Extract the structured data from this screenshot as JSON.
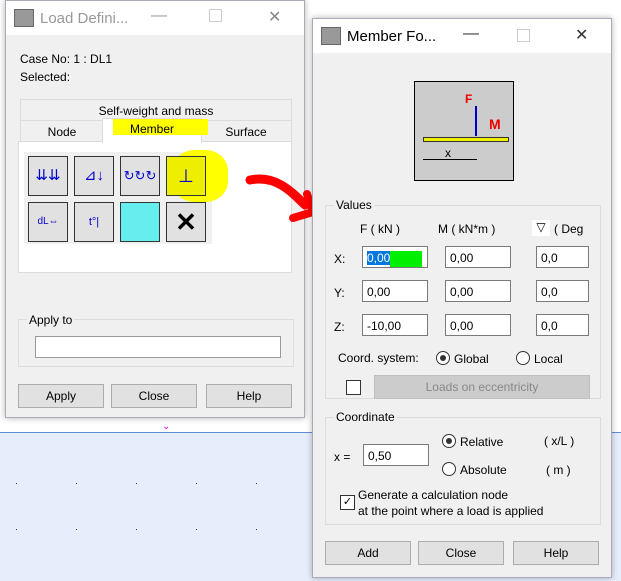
{
  "load_dialog": {
    "title": "Load Defini...",
    "case_no": "Case No: 1 : DL1",
    "selected": "Selected:",
    "tab_top": "Self-weight and mass",
    "tabs": [
      "Node",
      "Member",
      "Surface"
    ],
    "apply_to_label": "Apply to",
    "apply_to_value": "",
    "buttons": [
      "Apply",
      "Close",
      "Help"
    ],
    "tools": [
      "uniform-load-icon",
      "trapezoidal-load-icon",
      "moment-load-icon",
      "concentrated-force-icon",
      "dilatation-load-icon",
      "thermal-load-icon",
      "surface-load-icon",
      "delete-load-icon"
    ]
  },
  "member_dialog": {
    "title": "Member Fo...",
    "values_label": "Values",
    "col_headers": [
      "F  ( kN )",
      "M  ( kN*m )",
      "( Deg"
    ],
    "rows": [
      {
        "axis": "X:",
        "f": "0,00",
        "m": "0,00",
        "deg": "0,0"
      },
      {
        "axis": "Y:",
        "f": "0,00",
        "m": "0,00",
        "deg": "0,0"
      },
      {
        "axis": "Z:",
        "f": "-10,00",
        "m": "0,00",
        "deg": "0,0"
      }
    ],
    "diagram": {
      "f": "F",
      "m": "M",
      "x": "x"
    },
    "coord_label": "Coord. system:",
    "coord_options": [
      "Global",
      "Local"
    ],
    "coord_selected": "Global",
    "eccentricity_button": "Loads on eccentricity",
    "coordinate_label": "Coordinate",
    "x_label": "x =",
    "x_value": "0,50",
    "pos_options": [
      "Relative",
      "Absolute"
    ],
    "pos_selected": "Relative",
    "units": [
      "( x/L )",
      "( m )"
    ],
    "generate_node_checked": true,
    "generate_node_text_1": "Generate a calculation node",
    "generate_node_text_2": "at the point where a load is applied",
    "buttons": [
      "Add",
      "Close",
      "Help"
    ]
  },
  "highlight_color": "#ffff00",
  "arrow_color": "#ff0000"
}
